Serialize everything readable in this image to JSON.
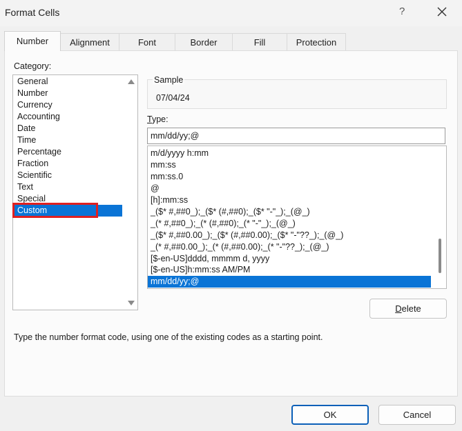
{
  "window": {
    "title": "Format Cells",
    "help_label": "?",
    "close_icon": "close-icon"
  },
  "tabs": [
    {
      "label": "Number",
      "active": true
    },
    {
      "label": "Alignment",
      "active": false
    },
    {
      "label": "Font",
      "active": false
    },
    {
      "label": "Border",
      "active": false
    },
    {
      "label": "Fill",
      "active": false
    },
    {
      "label": "Protection",
      "active": false
    }
  ],
  "category": {
    "label": "Category:",
    "items": [
      "General",
      "Number",
      "Currency",
      "Accounting",
      "Date",
      "Time",
      "Percentage",
      "Fraction",
      "Scientific",
      "Text",
      "Special",
      "Custom"
    ],
    "selected": "Custom"
  },
  "sample": {
    "label": "Sample",
    "value": "07/04/24"
  },
  "type": {
    "label": "Type:",
    "value": "mm/dd/yy;@"
  },
  "format_list": {
    "items": [
      "m/d/yyyy h:mm",
      "mm:ss",
      "mm:ss.0",
      "@",
      "[h]:mm:ss",
      "_($* #,##0_);_($* (#,##0);_($* \"-\"_);_(@_)",
      "_(* #,##0_);_(* (#,##0);_(* \"-\"_);_(@_)",
      "_($* #,##0.00_);_($* (#,##0.00);_($* \"-\"??_);_(@_)",
      "_(* #,##0.00_);_(* (#,##0.00);_(* \"-\"??_);_(@_)",
      "[$-en-US]dddd, mmmm d, yyyy",
      "[$-en-US]h:mm:ss AM/PM",
      "mm/dd/yy;@"
    ],
    "selected": "mm/dd/yy;@"
  },
  "buttons": {
    "delete": "Delete",
    "ok": "OK",
    "cancel": "Cancel"
  },
  "footer": {
    "hint": "Type the number format code, using one of the existing codes as a starting point."
  },
  "colors": {
    "selection": "#0a74d6",
    "highlight_box": "#e02020"
  }
}
